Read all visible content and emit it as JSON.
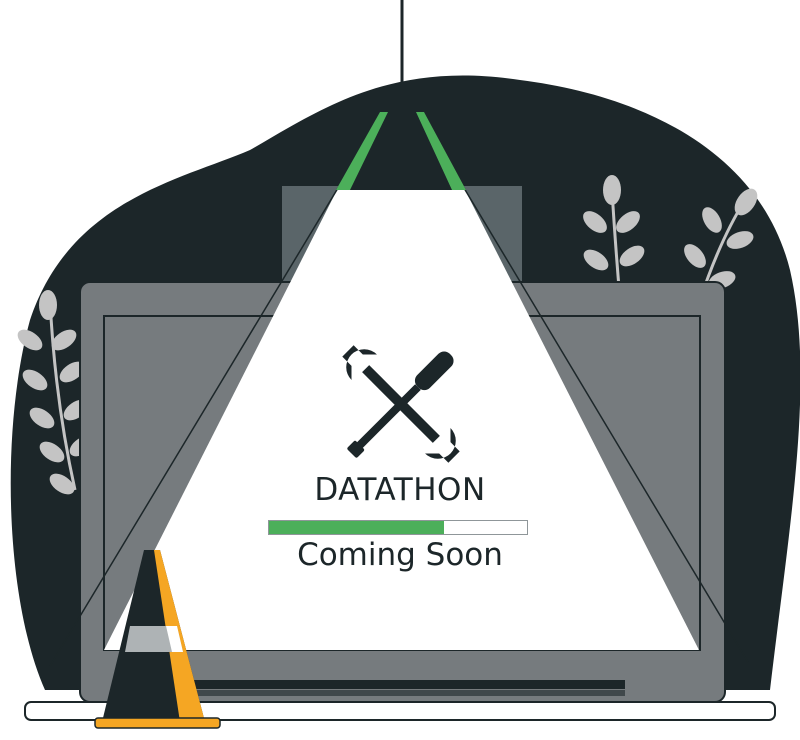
{
  "screen": {
    "title": "DATATHON",
    "subtitle": "Coming Soon",
    "progress_fraction": 0.68
  },
  "icons": {
    "tools": "crossed-screwdriver-and-wrench",
    "lamp": "hanging-lamp",
    "cone": "traffic-cone",
    "webcam": "webcam-dot"
  },
  "colors": {
    "dark": "#1c2629",
    "accent_green": "#4caf5a",
    "cone_orange": "#f5a623",
    "laptop_gray": "#767b7e",
    "leaf_gray": "#bdbdbd"
  }
}
